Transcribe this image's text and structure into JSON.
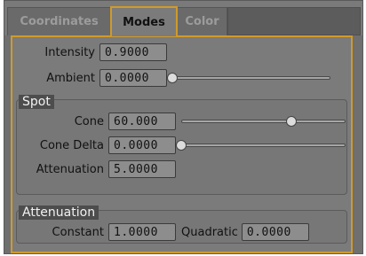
{
  "tabs": [
    {
      "label": "Coordinates",
      "active": false
    },
    {
      "label": "Modes",
      "active": true
    },
    {
      "label": "Color",
      "active": false
    }
  ],
  "fields": {
    "intensity": {
      "label": "Intensity",
      "value": "0.9000"
    },
    "ambient": {
      "label": "Ambient",
      "value": "0.0000",
      "slider_fraction": 0.0
    }
  },
  "spot": {
    "title": "Spot",
    "cone": {
      "label": "Cone",
      "value": "60.000",
      "slider_fraction": 0.67
    },
    "cone_delta": {
      "label": "Cone Delta",
      "value": "0.0000",
      "slider_fraction": 0.0
    },
    "attenuation": {
      "label": "Attenuation",
      "value": "5.0000"
    }
  },
  "attenuation_group": {
    "title": "Attenuation",
    "constant": {
      "label": "Constant",
      "value": "1.0000"
    },
    "quadratic": {
      "label": "Quadratic",
      "value": "0.0000"
    }
  },
  "colors": {
    "accent": "#d09a2a",
    "panel": "#7b7b7b"
  }
}
